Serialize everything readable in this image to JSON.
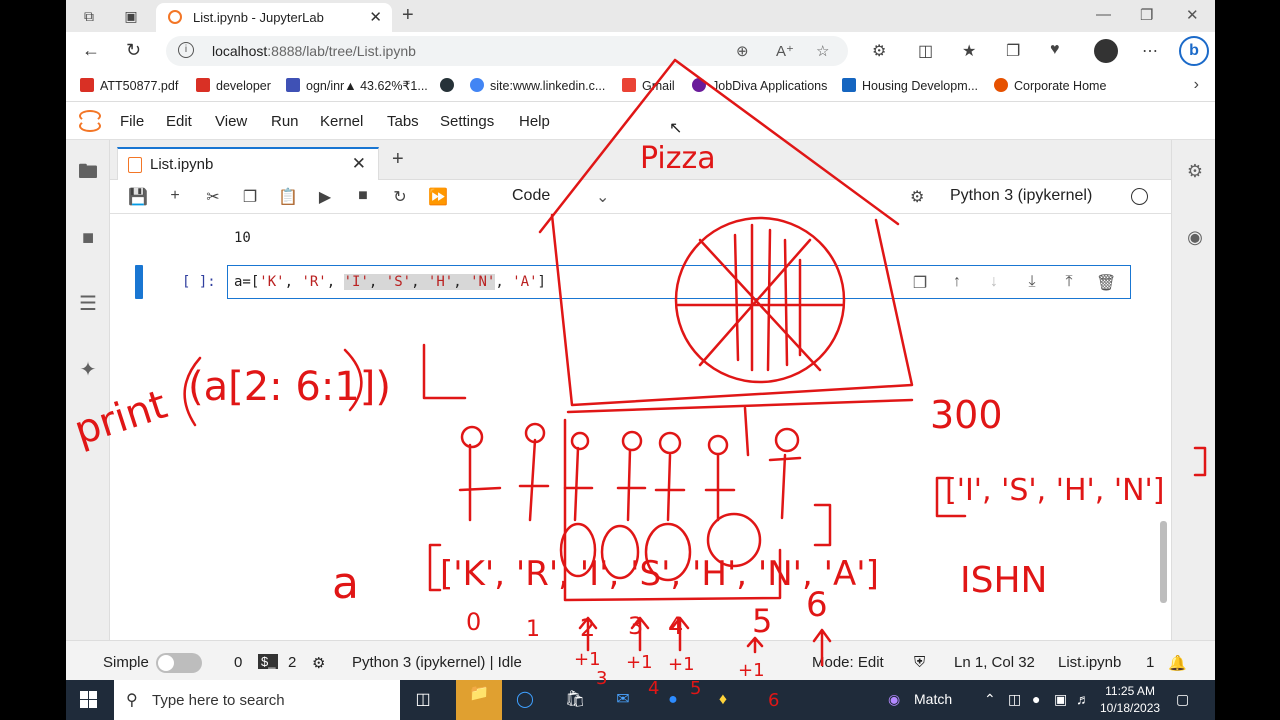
{
  "browser": {
    "tab_title": "List.ipynb - JupyterLab",
    "url_host": "localhost",
    "url_path": ":8888/lab/tree/List.ipynb",
    "bookmarks": [
      {
        "label": "ATT50877.pdf",
        "color": "#d93025"
      },
      {
        "label": "developer",
        "color": "#d93025"
      },
      {
        "label": "ogn/inr▲ 43.62%₹1...",
        "color": "#3f51b5"
      },
      {
        "label": "",
        "color": "#263238"
      },
      {
        "label": "site:www.linkedin.c...",
        "color": "#4285f4"
      },
      {
        "label": "Gmail",
        "color": "#ea4335"
      },
      {
        "label": "JobDiva Applications",
        "color": "#6a1b9a"
      },
      {
        "label": "Housing Developm...",
        "color": "#1565c0"
      },
      {
        "label": "Corporate Home",
        "color": "#e65100"
      }
    ]
  },
  "menu": {
    "items": [
      "File",
      "Edit",
      "View",
      "Run",
      "Kernel",
      "Tabs",
      "Settings",
      "Help"
    ]
  },
  "notebook": {
    "tab_label": "List.ipynb",
    "cell_type": "Code",
    "kernel_name": "Python 3 (ipykernel)",
    "previous_output": "10",
    "prompt": "[ ]:",
    "code_prefix": "a=[",
    "code_items": [
      "'K'",
      "'R'",
      "'I'",
      "'S'",
      "'H'",
      "'N'",
      "'A'"
    ],
    "code_suffix": "]"
  },
  "status": {
    "mode_label": "Simple",
    "terminals": "0",
    "kernels": "2",
    "kernel_status": "Python 3 (ipykernel) | Idle",
    "mode": "Mode: Edit",
    "cursor": "Ln 1, Col 32",
    "file": "List.ipynb",
    "notifications": "1"
  },
  "taskbar": {
    "search_placeholder": "Type here to search",
    "match_label": "Match",
    "time": "11:25 AM",
    "date": "10/18/2023"
  },
  "annotations": {
    "ink_color": "#e01616",
    "pizza_label": "Pizza",
    "print_text": "print",
    "slice_text": "(a[2: 6:1])",
    "bracket_text": "[",
    "result_list": "['I', 'S', 'H', 'N']",
    "result_word": "ISHN",
    "quantity": "300",
    "list_var": "a",
    "list_drawn": "['K', 'R', 'I', 'S', 'H', 'N', 'A']",
    "indices": [
      "0",
      "1",
      "2",
      "3",
      "4",
      "5",
      "6"
    ],
    "steps": [
      "+1",
      "+1",
      "+1",
      "+1"
    ],
    "step_totals": [
      "3",
      "4",
      "5",
      "6"
    ]
  }
}
